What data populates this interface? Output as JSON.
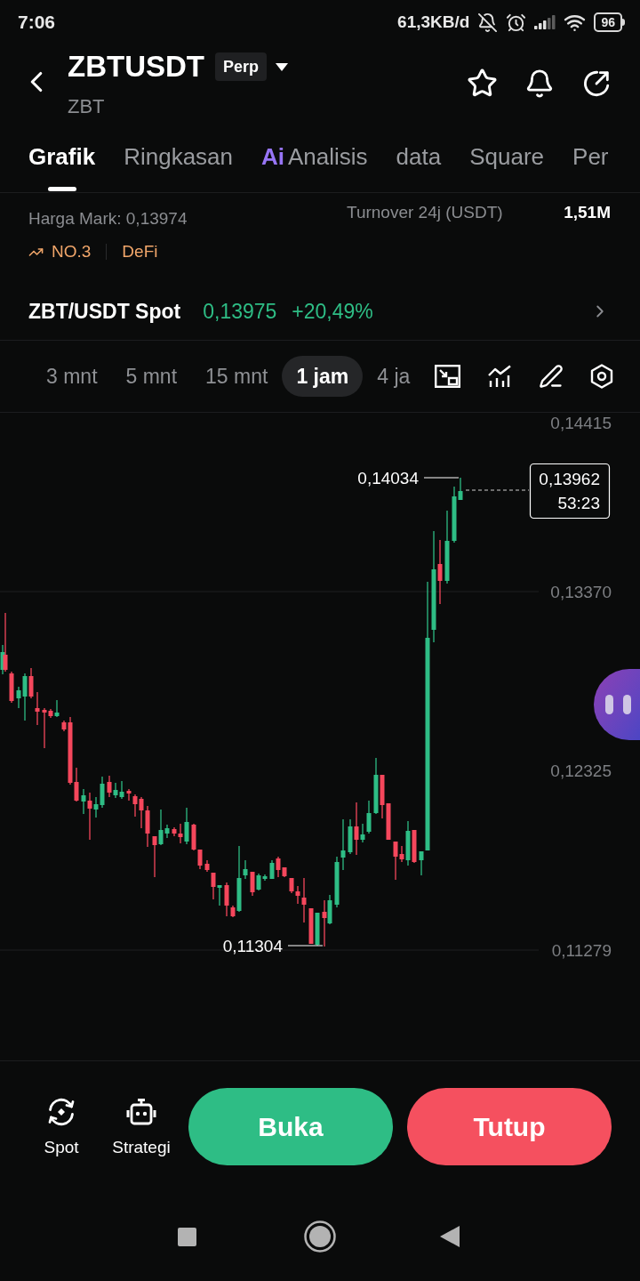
{
  "status_bar": {
    "time": "7:06",
    "network_speed": "61,3KB/d",
    "battery": "96"
  },
  "header": {
    "symbol": "ZBTUSDT",
    "contract_type": "Perp",
    "base_asset": "ZBT"
  },
  "tabs": [
    {
      "label": "Grafik",
      "selected": true
    },
    {
      "label": "Ringkasan",
      "selected": false
    },
    {
      "label": "Analisis",
      "selected": false,
      "badge": "Ai"
    },
    {
      "label": "data",
      "selected": false
    },
    {
      "label": "Square",
      "selected": false
    },
    {
      "label": "Per",
      "selected": false
    }
  ],
  "market_info": {
    "mark_price": "Harga Mark: 0,13974",
    "turnover_label": "Turnover 24j (USDT)",
    "turnover_value": "1,51M",
    "rank": "NO.3",
    "sector": "DeFi"
  },
  "spot_market": {
    "pair": "ZBT/USDT Spot",
    "price": "0,13975",
    "change": "+20,49%"
  },
  "intervals": [
    {
      "label": "3 mnt",
      "selected": false
    },
    {
      "label": "5 mnt",
      "selected": false
    },
    {
      "label": "15 mnt",
      "selected": false
    },
    {
      "label": "1 jam",
      "selected": true
    },
    {
      "label": "4 ja",
      "selected": false
    }
  ],
  "chart": {
    "price_axis": [
      "0,14415",
      "0,13370",
      "0,12325",
      "0,11279"
    ],
    "high": "0,14034",
    "low": "0,11304",
    "last_price": "0,13962",
    "countdown": "53:23"
  },
  "actions": {
    "shortcuts": [
      "Spot",
      "Strategi"
    ],
    "open_button": "Buka",
    "close_button": "Tutup"
  }
}
